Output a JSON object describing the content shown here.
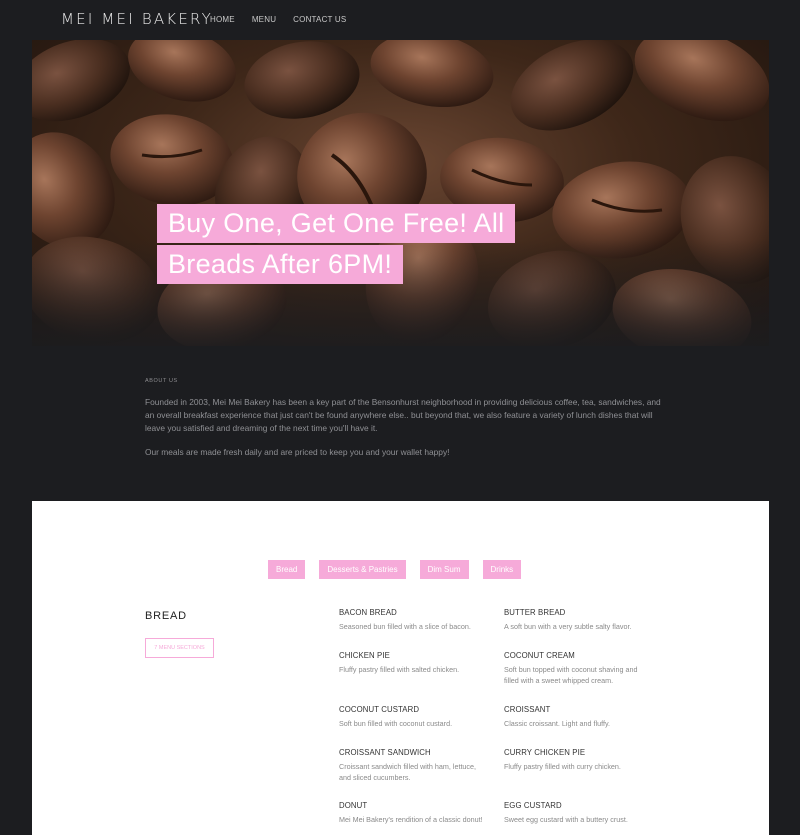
{
  "header": {
    "brand": "MEI MEI BAKERY",
    "nav": [
      "HOME",
      "MENU",
      "CONTACT US"
    ]
  },
  "hero": {
    "banner_line1": "Buy One, Get One Free! All",
    "banner_line2": "Breads After 6PM!"
  },
  "about": {
    "heading": "ABOUT US",
    "paragraph1": "Founded in 2003, Mei Mei Bakery has been a key part of the Bensonhurst neighborhood in providing delicious coffee, tea, sandwiches, and an overall breakfast experience that just can't be found anywhere else.. but beyond that, we also feature a variety of lunch dishes that will leave you satisfied and dreaming of the next time you'll have it.",
    "paragraph2": "Our meals are made fresh daily and are priced to keep you and your wallet happy!"
  },
  "menu": {
    "tabs": [
      "Bread",
      "Desserts & Pastries",
      "Dim Sum",
      "Drinks"
    ],
    "section_title": "BREAD",
    "sections_button": "7 MENU SECTIONS",
    "items": [
      {
        "name": "BACON BREAD",
        "desc": "Seasoned bun filled with a slice of bacon."
      },
      {
        "name": "BUTTER BREAD",
        "desc": "A soft bun with a very subtle salty flavor."
      },
      {
        "name": "CHICKEN PIE",
        "desc": "Fluffy pastry filled with salted chicken."
      },
      {
        "name": "COCONUT CREAM",
        "desc": "Soft bun topped with coconut shaving and filled with a sweet whipped cream."
      },
      {
        "name": "COCONUT CUSTARD",
        "desc": "Soft bun filled with coconut custard."
      },
      {
        "name": "CROISSANT",
        "desc": "Classic croissant. Light and fluffy."
      },
      {
        "name": "CROISSANT SANDWICH",
        "desc": "Croissant sandwich filled with ham, lettuce, and sliced cucumbers."
      },
      {
        "name": "CURRY CHICKEN PIE",
        "desc": "Fluffy pastry filled with curry chicken."
      },
      {
        "name": "DONUT",
        "desc": "Mei Mei Bakery's rendition of a classic donut!"
      },
      {
        "name": "EGG CUSTARD",
        "desc": "Sweet egg custard with a buttery crust."
      }
    ]
  },
  "colors": {
    "accent": "#f6aad9",
    "background": "#1c1d20"
  }
}
